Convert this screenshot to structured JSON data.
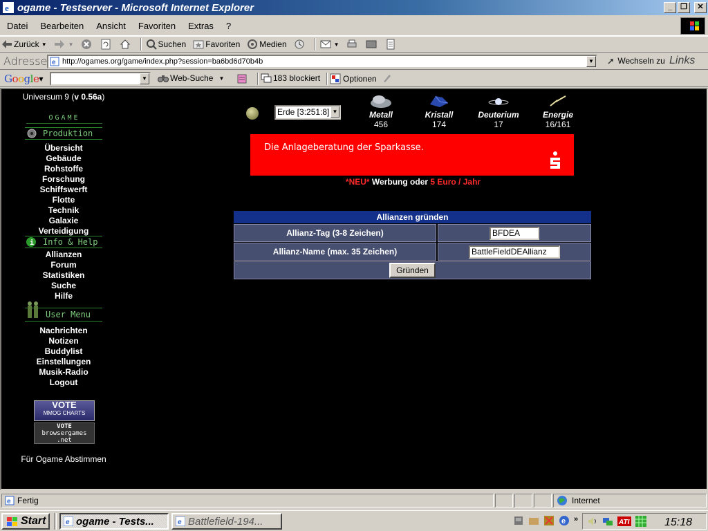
{
  "window": {
    "title": "ogame - Testserver - Microsoft Internet Explorer"
  },
  "menu": [
    "Datei",
    "Bearbeiten",
    "Ansicht",
    "Favoriten",
    "Extras",
    "?"
  ],
  "toolbar": {
    "back": "Zurück",
    "search": "Suchen",
    "favorites": "Favoriten",
    "media": "Medien"
  },
  "address": {
    "label": "Adresse",
    "url": "http://ogames.org/game/index.php?session=ba6bd6d70b4b",
    "go": "Wechseln zu",
    "links": "Links"
  },
  "google": {
    "logo": "Google",
    "search_label": "Web-Suche",
    "blocked": "183 blockiert",
    "options": "Optionen"
  },
  "leftnav": {
    "universe_prefix": "Universum 9 (",
    "universe_version": "v 0.56a",
    "universe_suffix": ")",
    "logo_text": "OGAME",
    "section_produktion": "Produktion",
    "produktion_items": [
      "Übersicht",
      "Gebäude",
      "Rohstoffe",
      "Forschung",
      "Schiffswerft",
      "Flotte",
      "Technik",
      "Galaxie",
      "Verteidigung"
    ],
    "section_info": "Info & Help",
    "info_items": [
      "Allianzen",
      "Forum",
      "Statistiken",
      "Suche",
      "Hilfe"
    ],
    "section_user": "User Menu",
    "user_items": [
      "Nachrichten",
      "Notizen",
      "Buddylist",
      "Einstellungen",
      "Musik-Radio",
      "Logout"
    ],
    "vote1_line1": "VOTE",
    "vote1_line2": "MMOG CHARTS",
    "vote2_line1": "VOTE",
    "vote2_line2": "browsergames",
    "vote2_line3": ".net",
    "abstimmen": "Für Ogame Abstimmen"
  },
  "resources": {
    "planet": "Erde [3:251:8]",
    "items": [
      {
        "name": "Metall",
        "value": "456"
      },
      {
        "name": "Kristall",
        "value": "174"
      },
      {
        "name": "Deuterium",
        "value": "17"
      },
      {
        "name": "Energie",
        "value": "16/161"
      }
    ]
  },
  "ad": {
    "text": "Die Anlageberatung der Sparkasse.",
    "line_new": "*NEU*",
    "line_mid": " Werbung oder ",
    "line_price": "5 Euro / Jahr"
  },
  "form": {
    "title": "Allianzen gründen",
    "tag_label": "Allianz-Tag (3-8 Zeichen)",
    "tag_value": "BFDEA",
    "name_label": "Allianz-Name (max. 35 Zeichen)",
    "name_value": "BattleFieldDEAllianz",
    "submit": "Gründen"
  },
  "status": {
    "text": "Fertig",
    "zone": "Internet"
  },
  "taskbar": {
    "start": "Start",
    "tasks": [
      "ogame - Tests...",
      "Battlefield-194..."
    ],
    "clock": "15:18"
  }
}
